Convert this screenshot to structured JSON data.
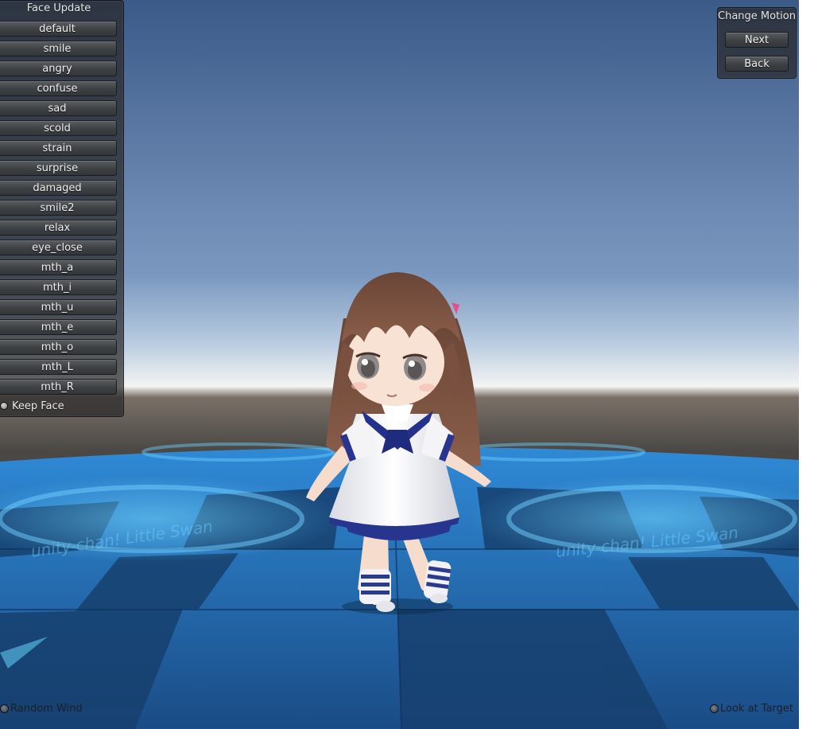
{
  "face_panel": {
    "title": "Face Update",
    "buttons": [
      "default",
      "smile",
      "angry",
      "confuse",
      "sad",
      "scold",
      "strain",
      "surprise",
      "damaged",
      "smile2",
      "relax",
      "eye_close",
      "mth_a",
      "mth_i",
      "mth_u",
      "mth_e",
      "mth_o",
      "mth_L",
      "mth_R"
    ],
    "keep_face": {
      "label": "Keep Face",
      "checked": true
    }
  },
  "motion_panel": {
    "title": "Change Motion",
    "next_label": "Next",
    "back_label": "Back"
  },
  "toggles": {
    "random_wind": {
      "label": "Random Wind",
      "checked": false
    },
    "look_at_target": {
      "label": "Look at Target",
      "checked": false
    }
  },
  "scene": {
    "floor_text": "unity-chan! Little Swan",
    "colors": {
      "sky_top": "#3b5886",
      "horizon": "#f4f4f2",
      "floor_tile_light": "#2c76c4",
      "floor_tile_dark": "#1b4f8c",
      "hair": "#7a5140",
      "dress": "#f2f2f4",
      "collar": "#23318a"
    }
  }
}
